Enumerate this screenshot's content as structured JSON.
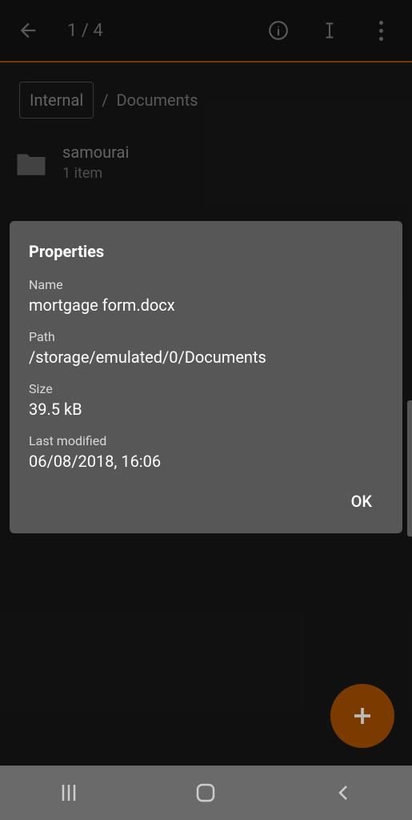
{
  "topbar": {
    "page_count": "1 / 4"
  },
  "breadcrumb": {
    "internal": "Internal",
    "sep": "/",
    "current": "Documents"
  },
  "list": {
    "items": [
      {
        "name": "samourai",
        "sub": "1 item"
      }
    ]
  },
  "dialog": {
    "title": "Properties",
    "name_label": "Name",
    "name_value": "mortgage form.docx",
    "path_label": "Path",
    "path_value": "/storage/emulated/0/Documents",
    "size_label": "Size",
    "size_value": "39.5 kB",
    "modified_label": "Last modified",
    "modified_value": "06/08/2018, 16:06",
    "ok": "OK"
  }
}
